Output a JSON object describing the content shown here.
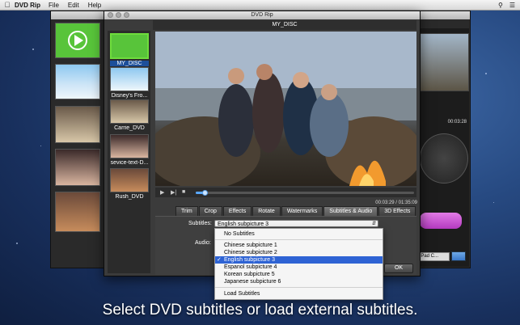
{
  "menubar": {
    "app_name": "DVD Rip",
    "items": [
      "File",
      "Edit",
      "Help"
    ]
  },
  "dialog": {
    "title": "DVD Rip",
    "disc_name": "MY_DISC",
    "sidebar_items": [
      {
        "label": "MY_DISC",
        "selected": true
      },
      {
        "label": "Disney's Fro..."
      },
      {
        "label": "Carrie_DVD"
      },
      {
        "label": "sevice-text-D..."
      },
      {
        "label": "Rush_DVD"
      }
    ],
    "time_display": "00:03:29 / 01:35:09",
    "progress_fraction": 0.04,
    "tabs": [
      "Trim",
      "Crop",
      "Effects",
      "Rotate",
      "Watermarks",
      "Subtitles & Audio",
      "3D Effects"
    ],
    "active_tab": "Subtitles & Audio",
    "subtitles_label": "Subtitles:",
    "audio_label": "Audio:",
    "subtitles_value": "English subpicture 3",
    "menu_items": [
      "No Subtitles",
      "Chinese subpicture 1",
      "Chinese subpicture 2",
      "English subpicture 3",
      "Espanol subpicture 4",
      "Korean subpicture 5",
      "Japanese subpicture 6",
      "Load Subtitles"
    ],
    "selected_menu_item": "English subpicture 3",
    "ok_label": "OK"
  },
  "background_window": {
    "time": "00:03:28",
    "pad_label": "iPad C..."
  },
  "caption": "Select DVD subtitles or load external subtitles.",
  "colors": {
    "selection_blue": "#2e63d4",
    "selected_thumb_border": "#6edc3c"
  }
}
